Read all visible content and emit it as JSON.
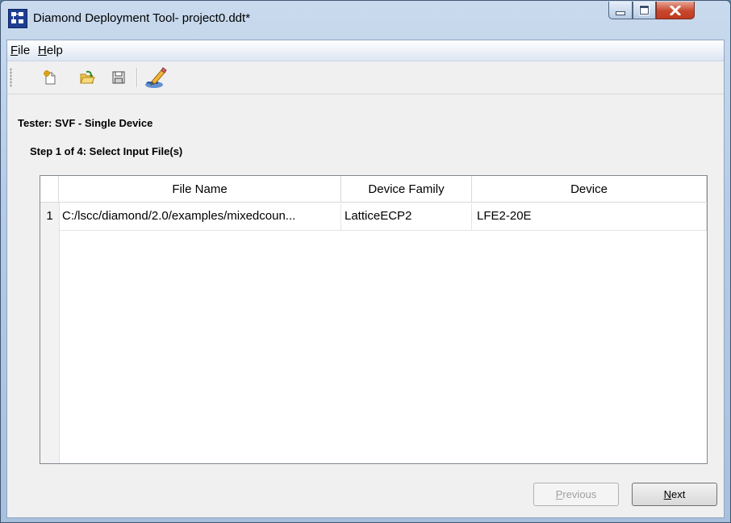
{
  "window": {
    "title": "Diamond Deployment Tool- project0.ddt*",
    "icon": "app-icon",
    "controls": [
      "minimize-icon",
      "maximize-icon",
      "close-icon"
    ]
  },
  "menu": {
    "items": [
      {
        "accel": "F",
        "rest": "ile"
      },
      {
        "accel": "H",
        "rest": "elp"
      }
    ]
  },
  "toolbar": {
    "buttons": [
      "new-file-icon",
      "open-file-icon",
      "save-icon",
      "edit-icon"
    ]
  },
  "tester_label": "Tester:  SVF - Single Device",
  "step_label": "Step 1 of 4: Select Input File(s)",
  "table": {
    "columns": [
      "File Name",
      "Device Family",
      "Device"
    ],
    "rows": [
      {
        "num": "1",
        "file_name": "C:/lscc/diamond/2.0/examples/mixedcoun...",
        "device_family": "LatticeECP2",
        "device": "LFE2-20E"
      }
    ]
  },
  "buttons": {
    "previous": {
      "accel": "P",
      "rest": "revious",
      "enabled": false
    },
    "next": {
      "accel": "N",
      "rest": "ext",
      "enabled": true
    }
  },
  "colors": {
    "title_bar": "#b6cbe4",
    "close_button": "#c7472d",
    "client_bg": "#f0f0f0"
  }
}
